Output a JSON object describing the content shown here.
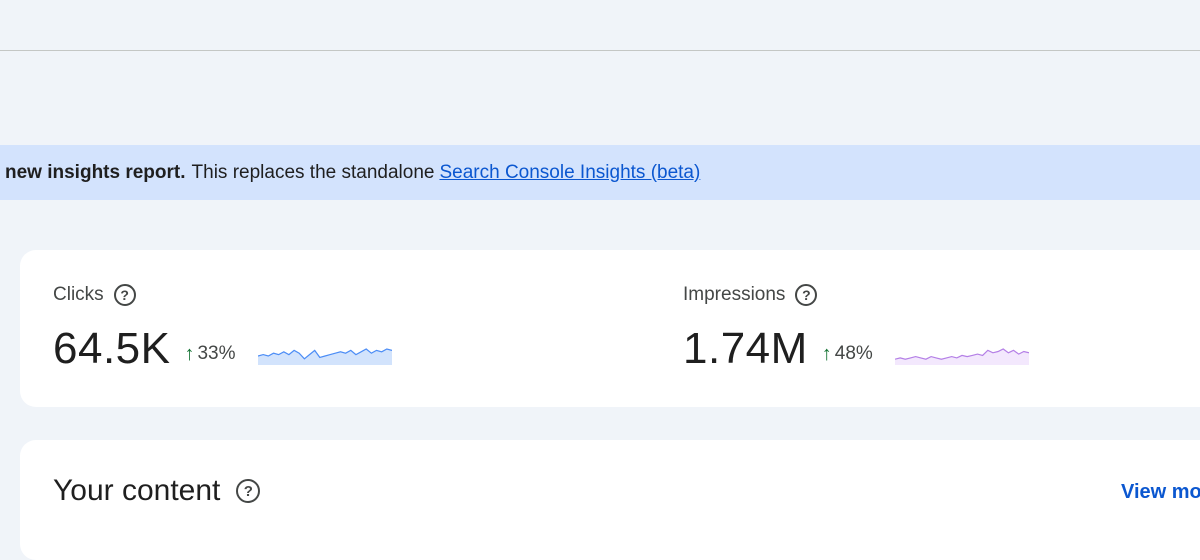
{
  "banner": {
    "bold_text": "new insights report.",
    "text": "This replaces the standalone",
    "link_text": "Search Console Insights (beta)"
  },
  "metrics": {
    "clicks": {
      "label": "Clicks",
      "value": "64.5K",
      "change": "33%",
      "sparkline_color": "#4c8df6",
      "sparkline_fill": "#d2e3fc",
      "trend": [
        5,
        6,
        5,
        7,
        6,
        8,
        6,
        9,
        7,
        3,
        6,
        9,
        4,
        5,
        6,
        7,
        8,
        7,
        9,
        6,
        8,
        10,
        7,
        9,
        8,
        10,
        9
      ]
    },
    "impressions": {
      "label": "Impressions",
      "value": "1.74M",
      "change": "48%",
      "sparkline_color": "#b47fe6",
      "sparkline_fill": "#f3e8fd",
      "trend": [
        3,
        4,
        3,
        4,
        5,
        4,
        3,
        5,
        4,
        3,
        4,
        5,
        4,
        6,
        5,
        6,
        7,
        6,
        10,
        8,
        9,
        11,
        8,
        10,
        7,
        9,
        8
      ]
    }
  },
  "your_content": {
    "title": "Your content",
    "view_more": "View mor"
  },
  "colors": {
    "background": "#f0f4f9",
    "banner": "#d3e3fd",
    "link": "#0b57d0",
    "positive": "#137333"
  }
}
